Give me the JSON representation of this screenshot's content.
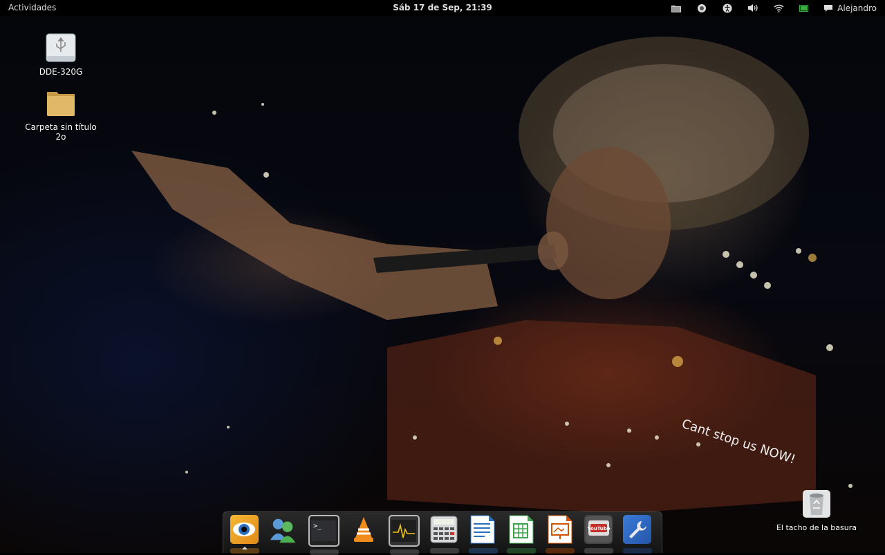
{
  "topbar": {
    "activities_label": "Actividades",
    "clock": "Sáb 17 de Sep, 21:39",
    "user_name": "Alejandro",
    "tray_icons": [
      "folder-icon",
      "record-icon",
      "accessibility-icon",
      "volume-icon",
      "wifi-icon",
      "battery-icon",
      "chat-icon"
    ]
  },
  "desktop": {
    "icons": [
      {
        "name": "usb-drive-icon",
        "label": "DDE-320G"
      },
      {
        "name": "folder-icon",
        "label": "Carpeta sin título 2o"
      },
      {
        "name": "trash-icon",
        "label": "El tacho de la basura"
      }
    ],
    "wallpaper_text": "Cant stop us NOW!"
  },
  "dock": {
    "apps": [
      {
        "name": "eye-of-gnome-icon",
        "running": true
      },
      {
        "name": "messenger-icon",
        "running": false
      },
      {
        "name": "terminal-icon",
        "running": false
      },
      {
        "name": "vlc-icon",
        "running": false
      },
      {
        "name": "system-monitor-icon",
        "running": false
      },
      {
        "name": "calculator-icon",
        "running": false
      },
      {
        "name": "writer-icon",
        "running": false
      },
      {
        "name": "calc-spreadsheet-icon",
        "running": false
      },
      {
        "name": "impress-icon",
        "running": false
      },
      {
        "name": "youtube-icon",
        "running": false
      },
      {
        "name": "settings-wrench-icon",
        "running": false
      }
    ]
  },
  "colors": {
    "topbar_bg": "#000000",
    "topbar_text": "#dddddd",
    "battery_green": "#3cb043"
  }
}
